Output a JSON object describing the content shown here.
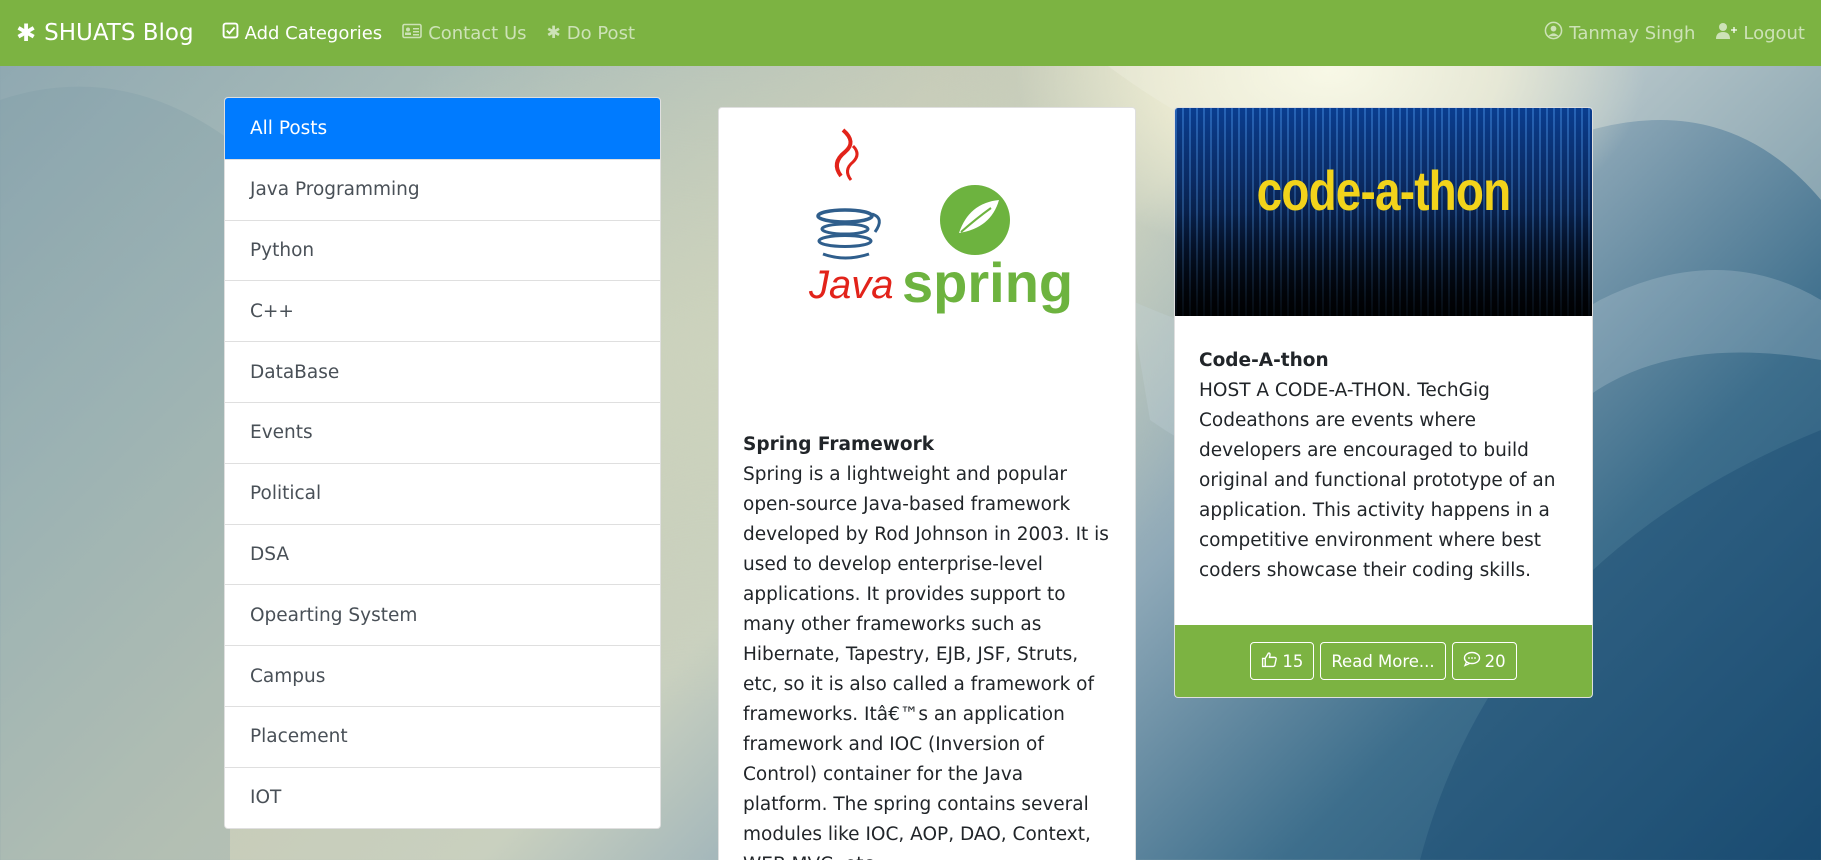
{
  "navbar": {
    "brand": "SHUATS Blog",
    "brand_icon": "asterisk-icon",
    "items": [
      {
        "label": "Add Categories",
        "icon": "check-square-icon",
        "active": true
      },
      {
        "label": "Contact Us",
        "icon": "address-card-icon",
        "active": false
      },
      {
        "label": "Do Post",
        "icon": "asterisk-icon",
        "active": false
      }
    ],
    "user": {
      "label": "Tanmay Singh",
      "icon": "user-circle-icon"
    },
    "logout": {
      "label": "Logout",
      "icon": "user-plus-icon"
    },
    "color": "#7cb342"
  },
  "categories": {
    "items": [
      "All Posts",
      "Java Programming",
      "Python",
      "C++",
      "DataBase",
      "Events",
      "Political",
      "DSA",
      "Opearting System",
      "Campus",
      "Placement",
      "IOT"
    ],
    "active_index": 0,
    "active_color": "#007bff"
  },
  "posts": [
    {
      "image": {
        "logo_left": "Java",
        "logo_right": "spring"
      },
      "title": "Spring Framework",
      "content": "Spring is a lightweight and popular open-source Java-based framework developed by Rod Johnson in 2003. It is used to develop enterprise-level applications. It provides support to many other frameworks such as Hibernate, Tapestry, EJB, JSF, Struts, etc, so it is also called a framework of frameworks. Itâ€™s an application framework and IOC (Inversion of Control) container for the Java platform. The spring contains several modules like IOC, AOP, DAO, Context, WEB MVC, etc."
    },
    {
      "image": {
        "logo_text": "code-a-thon"
      },
      "title": "Code-A-thon",
      "content": "HOST A CODE-A-THON. TechGig Codeathons are events where developers are encouraged to build original and functional prototype of an application. This activity happens in a competitive environment where best coders showcase their coding skills.",
      "likes": "15",
      "read_more": "Read More...",
      "comments": "20"
    }
  ]
}
